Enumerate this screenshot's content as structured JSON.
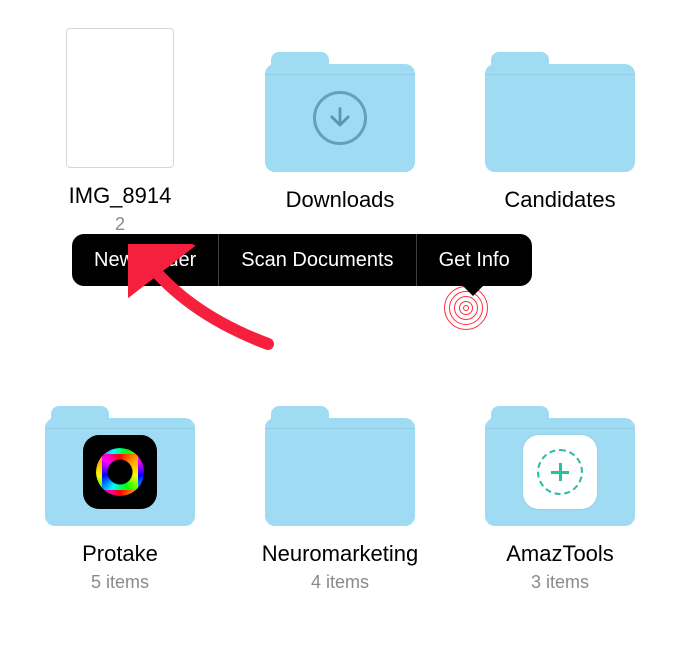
{
  "row1": [
    {
      "kind": "file",
      "name": "IMG_8914",
      "sub": "2"
    },
    {
      "kind": "folder",
      "name": "Downloads",
      "glyph": "download"
    },
    {
      "kind": "folder",
      "name": "Candidates"
    }
  ],
  "row2": [
    {
      "kind": "folder",
      "name": "Protake",
      "sub": "5 items",
      "app": "protake"
    },
    {
      "kind": "folder",
      "name": "Neuromarketing",
      "sub": "4 items"
    },
    {
      "kind": "folder",
      "name": "AmazTools",
      "sub": "3 items",
      "app": "amaz"
    }
  ],
  "context_menu": {
    "items": [
      "New Folder",
      "Scan Documents",
      "Get Info"
    ]
  },
  "colors": {
    "folder": "#9fdbf3",
    "arrow": "#f5203e"
  }
}
